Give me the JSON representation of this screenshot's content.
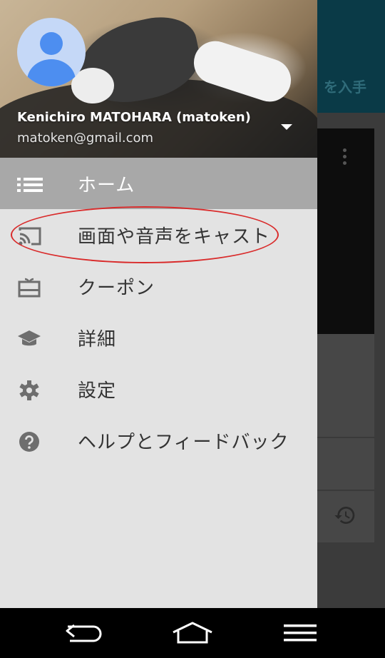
{
  "background_app": {
    "topbar_text": "を入手"
  },
  "drawer": {
    "account": {
      "name": "Kenichiro MATOHARA (matoken)",
      "email": "matoken@gmail.com"
    },
    "menu": [
      {
        "label": "ホーム",
        "icon": "list-icon",
        "active": true
      },
      {
        "label": "画面や音声をキャスト",
        "icon": "cast-icon",
        "active": false,
        "annotated": true
      },
      {
        "label": "クーポン",
        "icon": "gift-card-icon",
        "active": false
      },
      {
        "label": "詳細",
        "icon": "school-icon",
        "active": false
      },
      {
        "label": "設定",
        "icon": "gear-icon",
        "active": false
      },
      {
        "label": "ヘルプとフィードバック",
        "icon": "help-icon",
        "active": false
      }
    ]
  },
  "colors": {
    "drawer_bg": "#e3e3e3",
    "active_item_bg": "#a8a8a8",
    "annotation": "#d92b2b",
    "avatar_blue": "#4d8ef0"
  }
}
